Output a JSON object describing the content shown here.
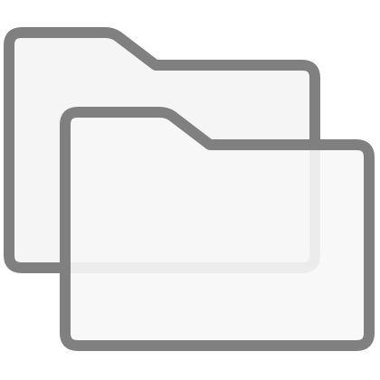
{
  "icon": {
    "name": "folders-icon",
    "colors": {
      "stroke": "#808080",
      "fill_back": "#f5f5f5",
      "fill_front": "#f7f7f7",
      "background": "#ffffff"
    }
  }
}
